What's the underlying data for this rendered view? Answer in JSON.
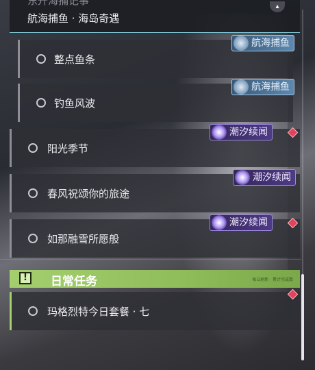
{
  "header": {
    "cut_title": "东升海捕记事",
    "subtitle": "航海捕鱼 · 海岛奇遇",
    "pin_icon": "pin-icon"
  },
  "quests": [
    {
      "label": "整点鱼条",
      "tag": "航海捕鱼",
      "tag_type": "sea",
      "alert": false
    },
    {
      "label": "钓鱼风波",
      "tag": "航海捕鱼",
      "tag_type": "sea",
      "alert": false
    },
    {
      "label": "阳光季节",
      "tag": "潮汐续闻",
      "tag_type": "tide",
      "alert": true
    },
    {
      "label": "春风祝颂你的旅途",
      "tag": "潮汐续闻",
      "tag_type": "tide",
      "alert": false
    },
    {
      "label": "如那融雪所愿般",
      "tag": "潮汐续闻",
      "tag_type": "tide",
      "alert": true
    }
  ],
  "daily_section": {
    "title": "日常任务",
    "small_text": "每日刷新 · 累计完成数",
    "icon": "exclamation-box-icon"
  },
  "daily_quests": [
    {
      "label": "玛格烈特今日套餐 · 七",
      "alert": true
    }
  ],
  "colors": {
    "sea_tag": "#4f7aa0",
    "tide_tag": "#4e3a86",
    "alert": "#e2435c",
    "daily_accent": "#a5cf6e",
    "header_line": "#7ec9d8"
  }
}
